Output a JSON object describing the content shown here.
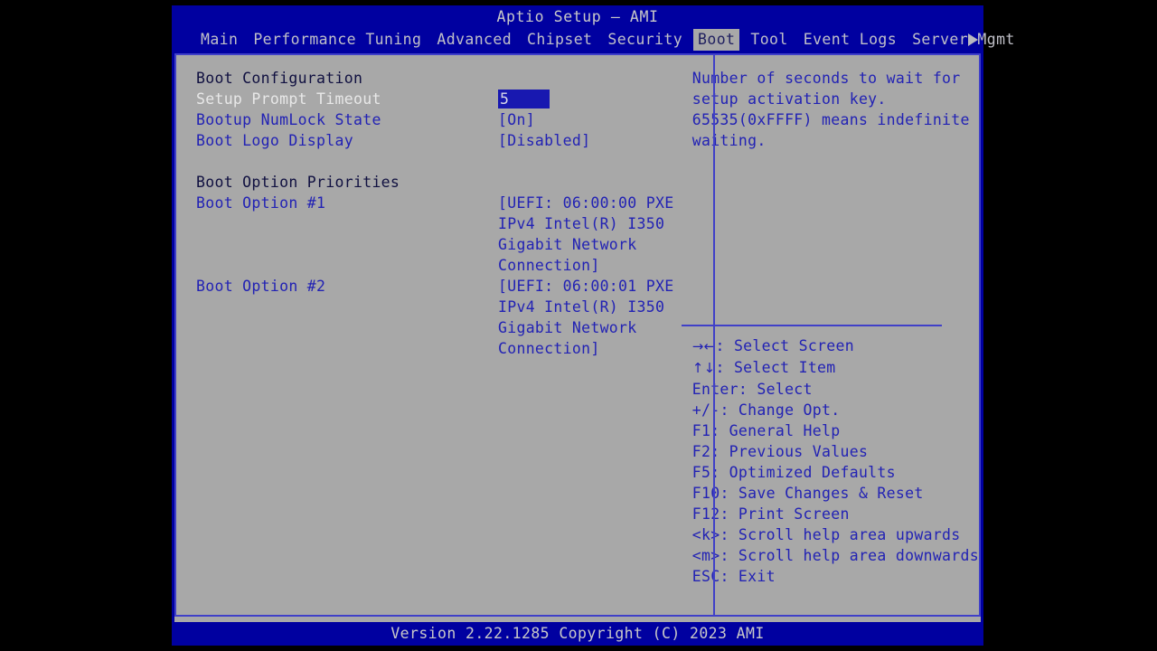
{
  "window": {
    "title": "Aptio Setup – AMI"
  },
  "menu": {
    "items": [
      {
        "label": "Main",
        "active": false
      },
      {
        "label": "Performance Tuning",
        "active": false
      },
      {
        "label": "Advanced",
        "active": false
      },
      {
        "label": "Chipset",
        "active": false
      },
      {
        "label": "Security",
        "active": false
      },
      {
        "label": "Boot",
        "active": true
      },
      {
        "label": "Tool",
        "active": false
      },
      {
        "label": "Event Logs",
        "active": false
      },
      {
        "label": "Server Mgmt",
        "active": false
      }
    ],
    "scroll_right_icon": "chevron-right-icon"
  },
  "settings": {
    "section_1_title": "Boot Configuration",
    "rows": [
      {
        "label": "Setup Prompt Timeout",
        "value": "5",
        "selected": true
      },
      {
        "label": "Bootup NumLock State",
        "value": "[On]",
        "selected": false
      },
      {
        "label": "Boot Logo Display",
        "value": "[Disabled]",
        "selected": false
      }
    ],
    "section_2_title": "Boot Option Priorities",
    "boot_options": [
      {
        "label": "Boot Option #1",
        "value": "[UEFI: 06:00:00 PXE\nIPv4 Intel(R) I350\nGigabit Network\nConnection]"
      },
      {
        "label": "Boot Option #2",
        "value": "[UEFI: 06:00:01 PXE\nIPv4 Intel(R) I350\nGigabit Network\nConnection]"
      }
    ]
  },
  "help": {
    "description_lines": [
      "Number of seconds to wait for",
      "setup activation key.",
      "65535(0xFFFF) means indefinite",
      "waiting."
    ],
    "legend": [
      {
        "key": "→←",
        "text": ": Select Screen"
      },
      {
        "key": "↑↓",
        "text": ": Select Item"
      },
      {
        "key": "Enter",
        "text": ": Select"
      },
      {
        "key": "+/-",
        "text": ": Change Opt."
      },
      {
        "key": "F1",
        "text": ": General Help"
      },
      {
        "key": "F2",
        "text": ": Previous Values"
      },
      {
        "key": "F5",
        "text": ": Optimized Defaults"
      },
      {
        "key": "F10",
        "text": ": Save Changes & Reset"
      },
      {
        "key": "F12",
        "text": ": Print Screen"
      },
      {
        "key": "<k>",
        "text": ": Scroll help area upwards"
      },
      {
        "key": "<m>",
        "text": ": Scroll help area downwards"
      },
      {
        "key": "ESC",
        "text": ": Exit"
      }
    ]
  },
  "footer": {
    "version_text": "Version 2.22.1285 Copyright (C) 2023 AMI"
  },
  "colors": {
    "background": "#000000",
    "window_blue": "#0000a0",
    "content_gray": "#a8a8a8",
    "border_blue": "#4040c8",
    "text_blue": "#2222b4",
    "text_light": "#c8c8c8",
    "highlight_bg": "#1818b0",
    "tab_active_bg": "#a8a8a8"
  }
}
